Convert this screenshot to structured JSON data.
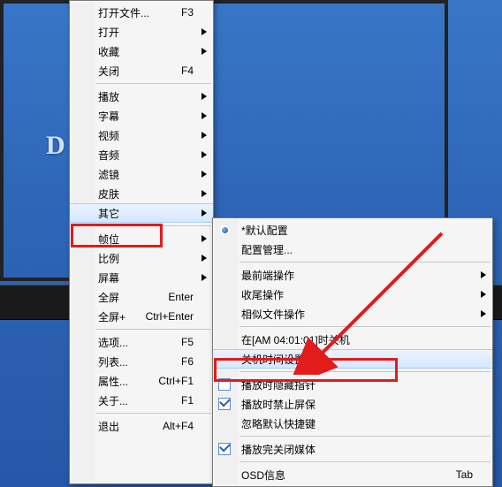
{
  "app_letter": "D",
  "menu1": {
    "groups": [
      [
        {
          "label": "打开文件...",
          "shortcut": "F3",
          "submenu": false
        },
        {
          "label": "打开",
          "shortcut": "",
          "submenu": true
        },
        {
          "label": "收藏",
          "shortcut": "",
          "submenu": true
        },
        {
          "label": "关闭",
          "shortcut": "F4",
          "submenu": false
        }
      ],
      [
        {
          "label": "播放",
          "shortcut": "",
          "submenu": true
        },
        {
          "label": "字幕",
          "shortcut": "",
          "submenu": true
        },
        {
          "label": "视频",
          "shortcut": "",
          "submenu": true
        },
        {
          "label": "音频",
          "shortcut": "",
          "submenu": true
        },
        {
          "label": "滤镜",
          "shortcut": "",
          "submenu": true
        },
        {
          "label": "皮肤",
          "shortcut": "",
          "submenu": true
        },
        {
          "label": "其它",
          "shortcut": "",
          "submenu": true,
          "highlight": true
        }
      ],
      [
        {
          "label": "帧位",
          "shortcut": "",
          "submenu": true
        },
        {
          "label": "比例",
          "shortcut": "",
          "submenu": true
        },
        {
          "label": "屏幕",
          "shortcut": "",
          "submenu": true
        },
        {
          "label": "全屏",
          "shortcut": "Enter",
          "submenu": false
        },
        {
          "label": "全屏+",
          "shortcut": "Ctrl+Enter",
          "submenu": false
        }
      ],
      [
        {
          "label": "选项...",
          "shortcut": "F5",
          "submenu": false
        },
        {
          "label": "列表...",
          "shortcut": "F6",
          "submenu": false
        },
        {
          "label": "属性...",
          "shortcut": "Ctrl+F1",
          "submenu": false
        },
        {
          "label": "关于...",
          "shortcut": "F1",
          "submenu": false
        }
      ],
      [
        {
          "label": "退出",
          "shortcut": "Alt+F4",
          "submenu": false
        }
      ]
    ]
  },
  "menu2": {
    "groups": [
      [
        {
          "label": "*默认配置",
          "radio": true
        },
        {
          "label": "配置管理..."
        }
      ],
      [
        {
          "label": "最前端操作",
          "submenu": true
        },
        {
          "label": "收尾操作",
          "submenu": true
        },
        {
          "label": "相似文件操作",
          "submenu": true
        }
      ],
      [
        {
          "label": "在[AM 04:01:01]时关机"
        },
        {
          "label": "关机时间设置...",
          "highlight": true
        }
      ],
      [
        {
          "label": "播放时隐藏指针",
          "checkbox": true,
          "checked": false
        },
        {
          "label": "播放时禁止屏保",
          "checkbox": true,
          "checked": true
        },
        {
          "label": "忽略默认快捷键"
        }
      ],
      [
        {
          "label": "播放完关闭媒体",
          "checkbox": true,
          "checked": true
        }
      ],
      [
        {
          "label": "OSD信息",
          "shortcut": "Tab"
        }
      ]
    ]
  }
}
